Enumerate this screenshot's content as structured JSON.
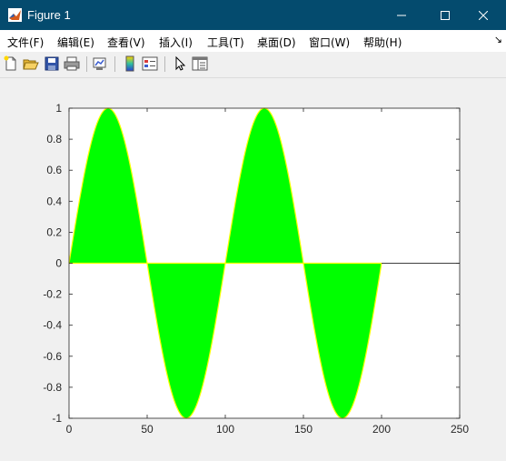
{
  "window": {
    "title": "Figure 1",
    "icon": "matlab-icon",
    "controls": [
      "minimize-icon",
      "maximize-icon",
      "close-icon"
    ],
    "titlebar_color": "#044b6e"
  },
  "menu": {
    "items": [
      "文件(F)",
      "编辑(E)",
      "查看(V)",
      "插入(I)",
      "工具(T)",
      "桌面(D)",
      "窗口(W)",
      "帮助(H)"
    ],
    "overflow": "↘"
  },
  "toolbar": {
    "buttons": [
      "new-figure-icon",
      "open-file-icon",
      "save-icon",
      "print-icon",
      "link-plot-icon",
      "insert-colorbar-icon",
      "insert-legend-icon",
      "edit-plot-icon",
      "open-property-inspector-icon"
    ]
  },
  "chart_data": {
    "type": "area",
    "title": "",
    "xlabel": "",
    "ylabel": "",
    "xlim": [
      0,
      250
    ],
    "ylim": [
      -1,
      1
    ],
    "xticks": [
      0,
      50,
      100,
      150,
      200,
      250
    ],
    "yticks": [
      -1,
      -0.8,
      -0.6,
      -0.4,
      -0.2,
      0,
      0.2,
      0.4,
      0.6,
      0.8,
      1
    ],
    "grid": false,
    "fill_color": "#00ff00",
    "edge_color": "#ffff00",
    "series": [
      {
        "function": "sin(2*pi*x/100)",
        "x": [
          0,
          12.5,
          25,
          37.5,
          50,
          62.5,
          75,
          87.5,
          100,
          112.5,
          125,
          137.5,
          150,
          162.5,
          175,
          187.5,
          200
        ],
        "y": [
          0,
          0.707,
          1,
          0.707,
          0,
          -0.707,
          -1,
          -0.707,
          0,
          0.707,
          1,
          0.707,
          0,
          -0.707,
          -1,
          -0.707,
          0
        ]
      }
    ],
    "baseline": 0
  }
}
